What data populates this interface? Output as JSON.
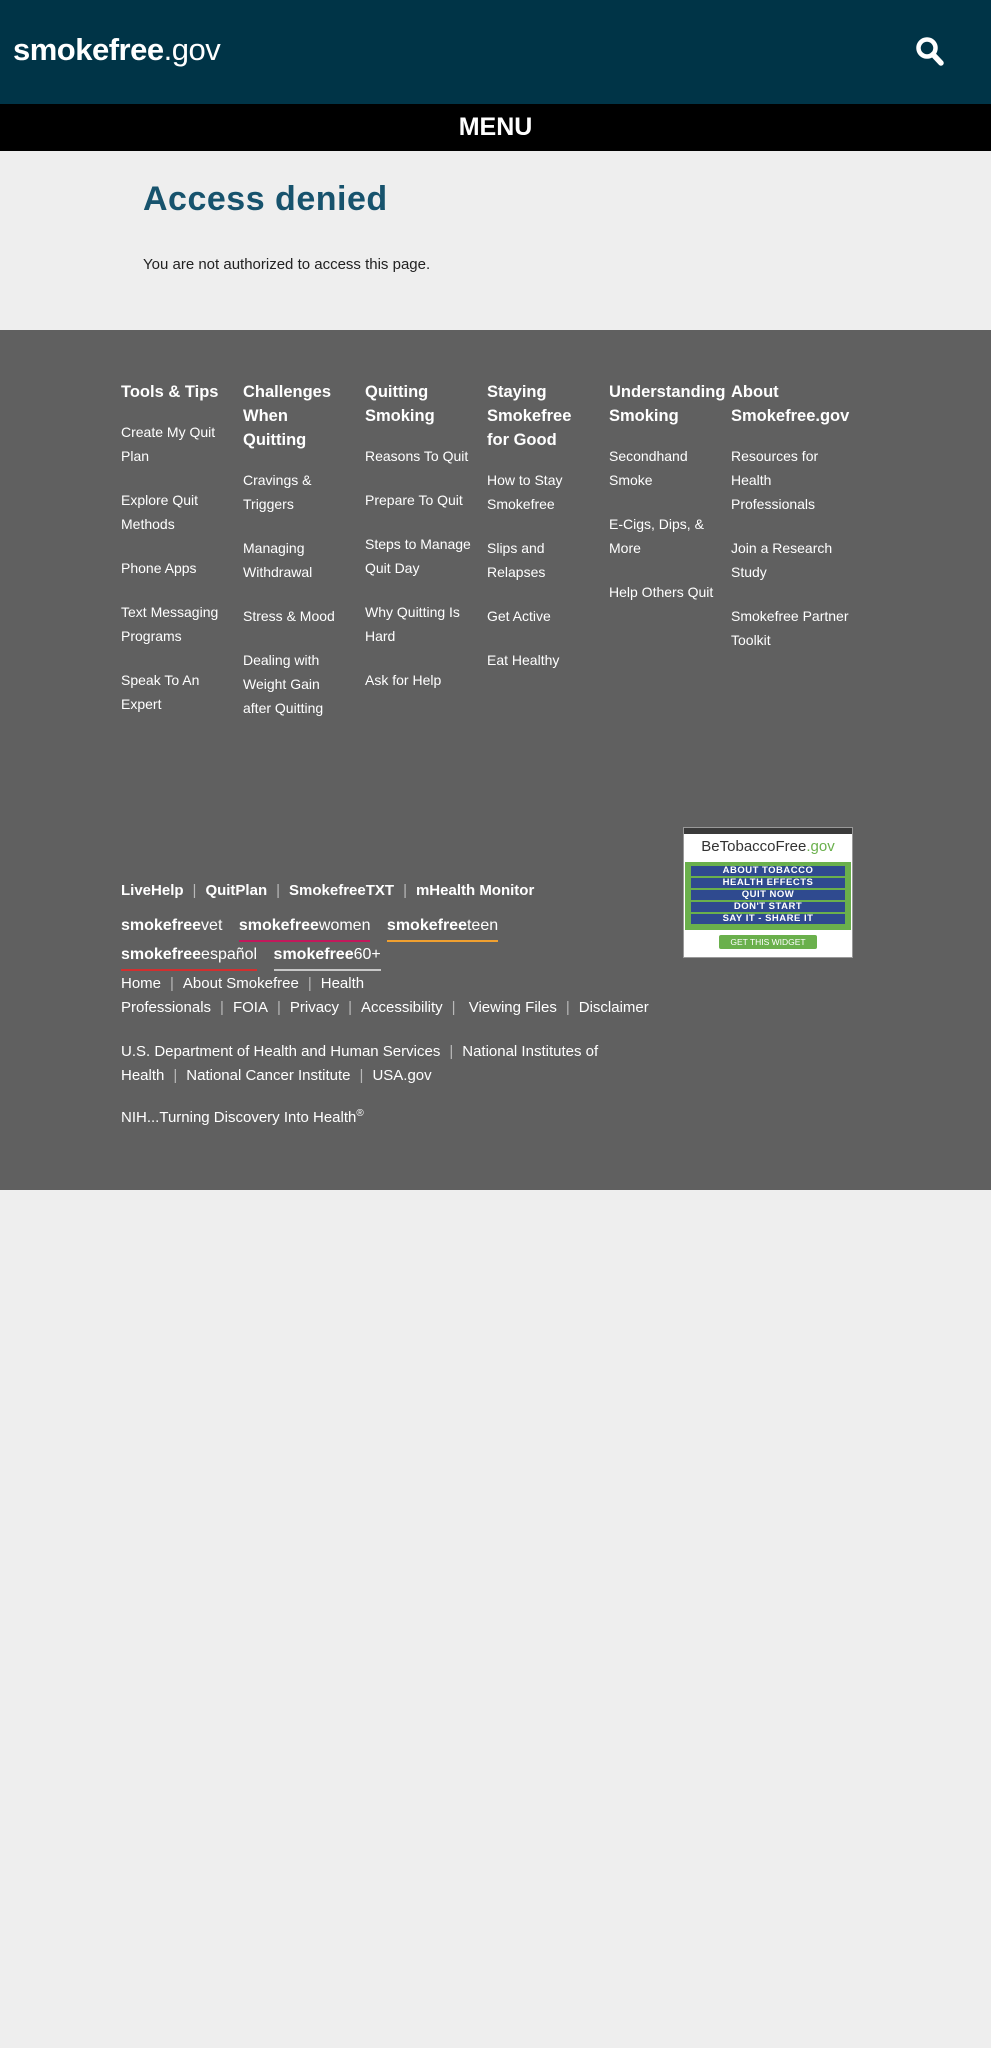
{
  "header": {
    "logo_bold": "smokefree",
    "logo_light": ".gov",
    "search_icon": "search-icon",
    "menu_label": "MENU"
  },
  "main": {
    "title": "Access denied",
    "message": "You are not authorized to access this page."
  },
  "footer": {
    "columns": [
      {
        "heading": "Tools & Tips",
        "links": [
          "Create My Quit Plan",
          "Explore Quit Methods",
          "Phone Apps",
          "Text Messaging Programs",
          "Speak To An Expert"
        ]
      },
      {
        "heading": "Challenges When Quitting",
        "links": [
          "Cravings & Triggers",
          "Managing Withdrawal",
          "Stress & Mood",
          "Dealing with Weight Gain after Quitting"
        ]
      },
      {
        "heading": "Quitting Smoking",
        "links": [
          "Reasons To Quit",
          "Prepare To Quit",
          "Steps to Manage Quit Day",
          "Why Quitting Is Hard",
          "Ask for Help"
        ]
      },
      {
        "heading": "Staying Smokefree for Good",
        "links": [
          "How to Stay Smokefree",
          "Slips and Relapses",
          "Get Active",
          "Eat Healthy"
        ]
      },
      {
        "heading": "Understanding Smoking",
        "links": [
          "Secondhand Smoke",
          "E-Cigs, Dips, & More",
          "Help Others Quit"
        ]
      },
      {
        "heading": "About Smokefree.gov",
        "links": [
          "Resources for Health Professionals",
          "Join a Research Study",
          "Smokefree Partner Toolkit"
        ]
      }
    ],
    "programs": [
      "LiveHelp",
      "QuitPlan",
      "SmokefreeTXT",
      "mHealth Monitor"
    ],
    "brands": [
      {
        "bold": "smokefree",
        "light": "vet",
        "color": "#606060"
      },
      {
        "bold": "smokefree",
        "light": "women",
        "color": "#c2185b"
      },
      {
        "bold": "smokefree",
        "light": "teen",
        "color": "#f0a030"
      },
      {
        "bold": "smokefree",
        "light": "español",
        "color": "#d32f2f"
      },
      {
        "bold": "smokefree",
        "light": "60+",
        "color": "#c8c8c8"
      }
    ],
    "links": [
      "Home",
      "About Smokefree",
      "Health Professionals",
      "FOIA",
      "Privacy",
      "Accessibility",
      "Viewing Files",
      "Disclaimer"
    ],
    "agencies": [
      "U.S. Department of Health and Human Services",
      "National Institutes of Health",
      "National Cancer Institute",
      "USA.gov"
    ],
    "nih_tagline": "NIH...Turning Discovery Into Health",
    "nih_reg": "®",
    "widget": {
      "title_main": "BeTobaccoFree",
      "title_tld": ".gov",
      "buttons": [
        "ABOUT TOBACCO",
        "HEALTH EFFECTS",
        "QUIT NOW",
        "DON'T START",
        "SAY IT - SHARE IT"
      ],
      "cta": "GET THIS WIDGET"
    }
  },
  "colors": {
    "header_bg": "#003447",
    "menu_bg": "#000000",
    "title": "#17536d",
    "footer_bg": "#606060",
    "page_bg": "#eeeeee"
  }
}
